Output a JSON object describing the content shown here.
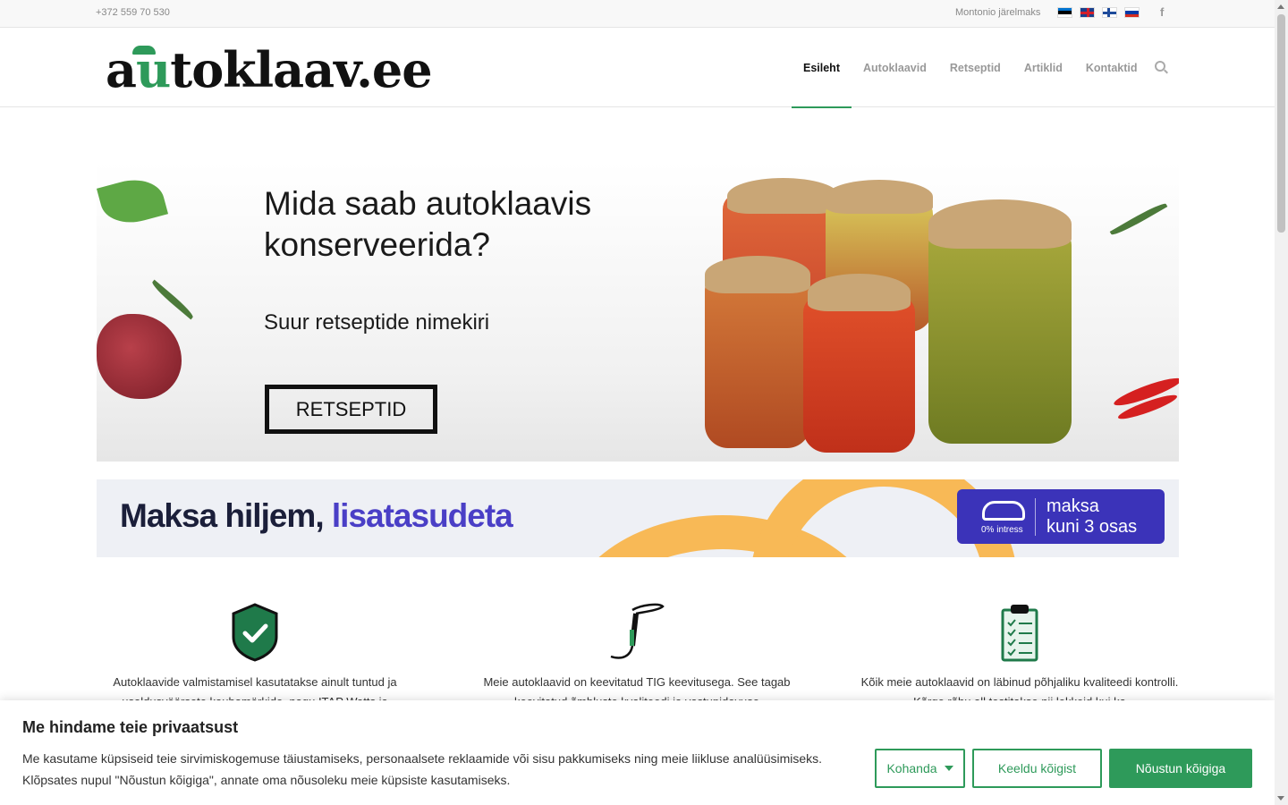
{
  "topbar": {
    "phone": "+372 559 70 530",
    "link": "Montonio järelmaks",
    "flags": [
      "Eesti",
      "English",
      "Suomi",
      "Русский"
    ],
    "social_icon": "facebook-icon",
    "fb_glyph": "f"
  },
  "header": {
    "logo_prefix": "a",
    "logo_u": "u",
    "logo_suffix": "toklaav.ee",
    "nav": [
      "Esileht",
      "Autoklaavid",
      "Retseptid",
      "Artiklid",
      "Kontaktid"
    ],
    "active_nav": "Esileht",
    "search_icon": "search-icon"
  },
  "hero": {
    "title": "Mida saab autoklaavis konserveerida?",
    "subtitle": "Suur retseptide nimekiri",
    "button": "RETSEPTID"
  },
  "payment_banner": {
    "text_main": "Maksa hiljem, ",
    "text_highlight": "lisatasudeta",
    "badge_interest": "0% intress",
    "badge_line1": "maksa",
    "badge_line2": "kuni 3 osas"
  },
  "features": [
    {
      "icon": "shield-check-icon",
      "text": "Autoklaavide valmistamisel kasutatakse ainult tuntud ja usaldusväärsete kaubamärkide, nagu ITAP Watts ja"
    },
    {
      "icon": "tig-torch-icon",
      "text": "Meie autoklaavid on keevitatud TIG keevitusega. See tagab keevitatud õmbluste kvaliteedi ja vastupidavuse"
    },
    {
      "icon": "clipboard-checklist-icon",
      "text": "Kõik meie autoklaavid on läbinud põhjaliku kvaliteedi kontrolli. Kõrge rõhu all testitakse nii lekkeid kui ka"
    }
  ],
  "cookie": {
    "title": "Me hindame teie privaatsust",
    "text": "Me kasutame küpsiseid teie sirvimiskogemuse täiustamiseks, personaalsete reklaamide või sisu pakkumiseks ning meie liikluse analüüsimiseks. Klõpsates nupul \"Nõustun kõigiga\", annate oma nõusoleku meie küpsiste kasutamiseks.",
    "btn_customize": "Kohanda",
    "btn_deny": "Keeldu kõigist",
    "btn_accept": "Nõustun kõigiga"
  },
  "colors": {
    "brand_green": "#2e9a5a",
    "payment_purple": "#3b33b9",
    "payment_orange": "#f8b956"
  }
}
